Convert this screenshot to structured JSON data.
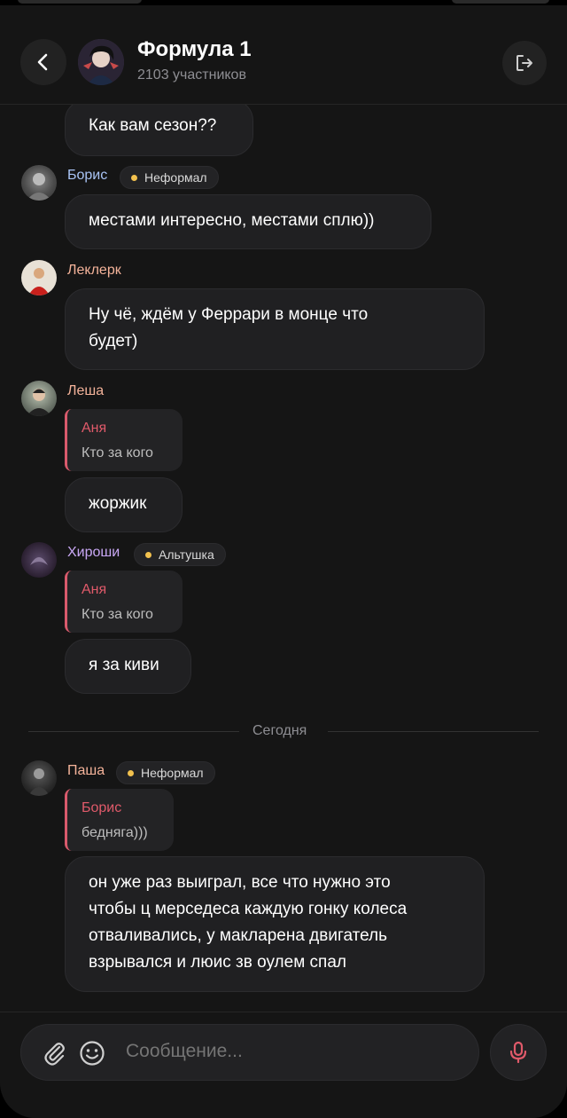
{
  "header": {
    "title": "Формула 1",
    "subtitle": "2103 участников"
  },
  "messages": [
    {
      "text": "Как вам сезон??"
    },
    {
      "sender": "Борис",
      "badge": "Неформал",
      "text": "местами интересно, местами сплю))"
    },
    {
      "sender": "Леклерк",
      "text_line1": "Ну чё, ждём у Феррари в монце что",
      "text_line2": "будет)"
    },
    {
      "sender": "Леша",
      "reply_author": "Аня",
      "reply_text": "Кто за кого",
      "text": "жоржик"
    },
    {
      "sender": "Хироши",
      "badge": "Альтушка",
      "reply_author": "Аня",
      "reply_text": "Кто за кого",
      "text": "я за киви"
    },
    {
      "sender": "Паша",
      "badge": "Неформал",
      "reply_author": "Борис",
      "reply_text": "бедняга)))",
      "text_line1": "он уже раз выиграл, все что нужно это",
      "text_line2": "чтобы ц мерседеса каждую гонку колеса",
      "text_line3": "отваливались, у макларена двигатель",
      "text_line4": "взрывался и люис зв оулем спал"
    }
  ],
  "divider": "Сегодня",
  "input": {
    "placeholder": "Сообщение..."
  },
  "colors": {
    "boris_name": "#a9c4f5",
    "leclerc_name": "#f4b39a",
    "lesha_name": "#f4b39a",
    "hiroshi_name": "#c9a8f5",
    "pasha_name": "#f4b39a",
    "reply_accent": "#e05a6a",
    "badge_dot": "#f2c14e",
    "mic": "#e05a6a"
  }
}
